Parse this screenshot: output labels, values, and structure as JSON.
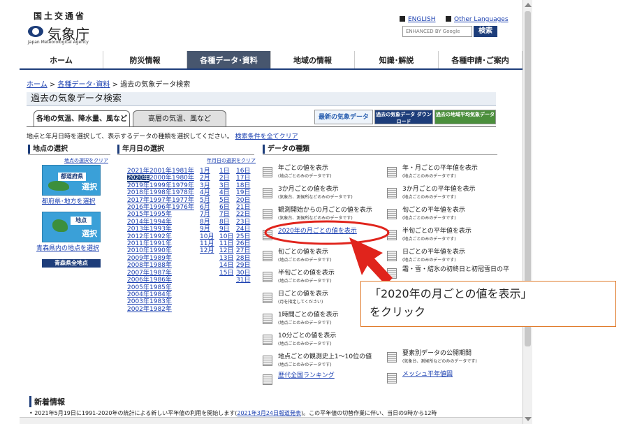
{
  "header": {
    "ministry": "国土交通省",
    "logo_text": "気象庁",
    "logo_en": "Japan Meteorological Agency",
    "english_link": "ENGLISH",
    "other_lang_link": "Other Languages",
    "search_placeholder": "ENHANCED BY Google",
    "search_button": "検索"
  },
  "nav": [
    {
      "label": "ホーム",
      "active": false
    },
    {
      "label": "防災情報",
      "active": false
    },
    {
      "label": "各種データ･資料",
      "active": true
    },
    {
      "label": "地域の情報",
      "active": false
    },
    {
      "label": "知識･解説",
      "active": false
    },
    {
      "label": "各種申請･ご案内",
      "active": false
    }
  ],
  "breadcrumb": {
    "home": "ホーム",
    "sep": ">",
    "section": "各種データ･資料",
    "current": "過去の気象データ検索"
  },
  "page_title": "過去の気象データ検索",
  "tabs": [
    "各地の気温、降水量、風など",
    "高層の気温、風など"
  ],
  "banners": [
    "最新の気象データ",
    "過去の気象データ ダウンロード",
    "過去の地域平均気象データ"
  ],
  "description": "地点と年月日時を選択して、表示するデータの種類を選択してください。",
  "clear_all": "検索条件を全てクリア",
  "location": {
    "heading": "地点の選択",
    "clear": "地点の選択をクリア",
    "pref_label": "都道府県",
    "pref_select": "選択",
    "pref_link": "都府県･地方を選択",
    "point_label": "地点",
    "point_select": "選択",
    "point_link": "青森県内の地点を選択",
    "all_points": "青森県全地点"
  },
  "date": {
    "heading": "年月日の選択",
    "clear": "年月日の選択をクリア",
    "years_col1": [
      "2021年",
      "2020年",
      "2019年",
      "2018年",
      "2017年",
      "2016年",
      "2015年",
      "2014年",
      "2013年",
      "2012年",
      "2011年",
      "2010年",
      "2009年",
      "2008年",
      "2007年",
      "2006年",
      "2005年",
      "2004年",
      "2003年",
      "2002年"
    ],
    "years_col2": [
      "2001年",
      "2000年",
      "1999年",
      "1998年",
      "1997年",
      "1996年",
      "1995年",
      "1994年",
      "1993年",
      "1992年",
      "1991年",
      "1990年",
      "1989年",
      "1988年",
      "1987年",
      "1986年",
      "1985年",
      "1984年",
      "1983年",
      "1982年"
    ],
    "years_col3": [
      "1981年",
      "1980年",
      "1979年",
      "1978年",
      "1977年",
      "1976年"
    ],
    "months": [
      "1月",
      "2月",
      "3月",
      "4月",
      "5月",
      "6月",
      "7月",
      "8月",
      "9月",
      "10月",
      "11月",
      "12月"
    ],
    "days_col1": [
      "1日",
      "2日",
      "3日",
      "4日",
      "5日",
      "6日",
      "7日",
      "8日",
      "9日",
      "10日",
      "11日",
      "12日",
      "13日",
      "14日",
      "15日"
    ],
    "days_col2": [
      "16日",
      "17日",
      "18日",
      "19日",
      "20日",
      "21日",
      "22日",
      "23日",
      "24日",
      "25日",
      "26日",
      "27日",
      "28日",
      "29日",
      "30日",
      "31日"
    ],
    "selected_year": "2020年"
  },
  "datatype": {
    "heading": "データの種類",
    "left": [
      {
        "main": "年ごとの値を表示",
        "sub": "(地点ごとのみのデータです)"
      },
      {
        "main": "3か月ごとの値を表示",
        "sub": "(気象台、測候所などのみのデータです)"
      },
      {
        "main": "観測開始からの月ごとの値を表示",
        "sub": "(気象台、測候所などのみのデータです)"
      },
      {
        "main": "2020年の月ごとの値を表示",
        "sub": ""
      },
      {
        "main": "旬ごとの値を表示",
        "sub": "(地点ごとのみのデータです)"
      },
      {
        "main": "半旬ごとの値を表示",
        "sub": "(地点ごとのみのデータです)"
      },
      {
        "main": "日ごとの値を表示",
        "sub": "(月を指定してください)"
      },
      {
        "main": "1時間ごとの値を表示",
        "sub": "(地点ごとのみのデータです)"
      },
      {
        "main": "10分ごとの値を表示",
        "sub": "(地点ごとのみのデータです)"
      },
      {
        "main": "地点ごとの観測史上1～10位の値",
        "sub": "(地点ごとのみのデータです)"
      },
      {
        "main": "歴代全国ランキング",
        "sub": ""
      }
    ],
    "right": [
      {
        "main": "年・月ごとの平年値を表示",
        "sub": "(地点ごとのみのデータです)"
      },
      {
        "main": "3か月ごとの平年値を表示",
        "sub": "(地点ごとのみのデータです)"
      },
      {
        "main": "旬ごとの平年値を表示",
        "sub": "(地点ごとのみのデータです)"
      },
      {
        "main": "半旬ごとの平年値を表示",
        "sub": "(地点ごとのみのデータです)"
      },
      {
        "main": "日ごとの平年値を表示",
        "sub": "(地点ごとのみのデータです)"
      },
      {
        "main": "霜・雪・結氷の初終日と初冠雪日の平",
        "sub": ""
      },
      {
        "main": "要素別データの公開期間",
        "sub": "(気象台、測候所などのみのデータです)"
      },
      {
        "main": "メッシュ平年値図",
        "sub": ""
      }
    ]
  },
  "news": {
    "heading": "新着情報",
    "item_before": "• 2021年5月19日に1991-2020年の統計による新しい平年値の利用を開始します(",
    "item_link": "2021年3月24日報道発表",
    "item_after": ")。この平年値の切替作業に伴い、当日の9時から12時"
  },
  "callout": {
    "line1": "「2020年の月ごとの値を表示」",
    "line2": "をクリック"
  },
  "colors": {
    "accent": "#1d3d7a",
    "highlight": "#e0241c",
    "callout_border": "#e07a2a"
  }
}
